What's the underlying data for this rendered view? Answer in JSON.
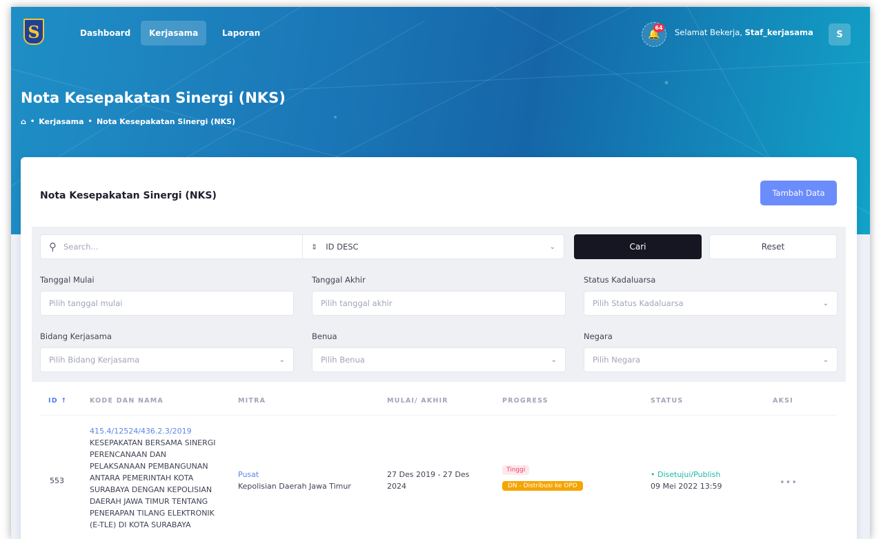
{
  "nav": {
    "items": [
      {
        "label": "Dashboard"
      },
      {
        "label": "Kerjasama",
        "active": true
      },
      {
        "label": "Laporan"
      }
    ],
    "notification_count": "64",
    "greeting_prefix": "Selamat Bekerja,",
    "username": "Staf_kerjasama",
    "avatar_initial": "S"
  },
  "header": {
    "title": "Nota Kesepakatan Sinergi (NKS)",
    "breadcrumb": [
      "Kerjasama",
      "Nota Kesepakatan Sinergi (NKS)"
    ]
  },
  "card": {
    "title": "Nota Kesepakatan Sinergi (NKS)",
    "add_button": "Tambah Data"
  },
  "filters": {
    "search_placeholder": "Search...",
    "sort_value": "ID DESC",
    "search_button": "Cari",
    "reset_button": "Reset",
    "tanggal_mulai": {
      "label": "Tanggal Mulai",
      "placeholder": "Pilih tanggal mulai"
    },
    "tanggal_akhir": {
      "label": "Tanggal Akhir",
      "placeholder": "Pilih tanggal akhir"
    },
    "status_kadaluarsa": {
      "label": "Status Kadaluarsa",
      "placeholder": "Pilih Status Kadaluarsa"
    },
    "bidang": {
      "label": "Bidang Kerjasama",
      "placeholder": "Pilih Bidang Kerjasama"
    },
    "benua": {
      "label": "Benua",
      "placeholder": "Pilih Benua"
    },
    "negara": {
      "label": "Negara",
      "placeholder": "Pilih Negara"
    }
  },
  "table": {
    "columns": [
      "ID",
      "KODE DAN NAMA",
      "MITRA",
      "MULAI/ AKHIR",
      "PROGRESS",
      "STATUS",
      "AKSI"
    ],
    "rows": [
      {
        "id": "553",
        "kode": "415.4/12524/436.2.3/2019",
        "nama": "KESEPAKATAN BERSAMA SINERGI PERENCANAAN DAN PELAKSANAAN PEMBANGUNAN ANTARA PEMERINTAH KOTA SURABAYA DENGAN KEPOLISIAN DAERAH JAWA TIMUR TENTANG PENERAPAN TILANG ELEKTRONIK (E-TLE) DI KOTA SURABAYA",
        "mitra_type": "Pusat",
        "mitra_name": "Kepolisian Daerah Jawa Timur",
        "periode": "27 Des 2019 - 27 Des 2024",
        "priority": "Tinggi",
        "progress": "DN - Distribusi ke OPD",
        "status": "Disetujui/Publish",
        "status_date": "09 Mei 2022 13:59"
      }
    ]
  }
}
